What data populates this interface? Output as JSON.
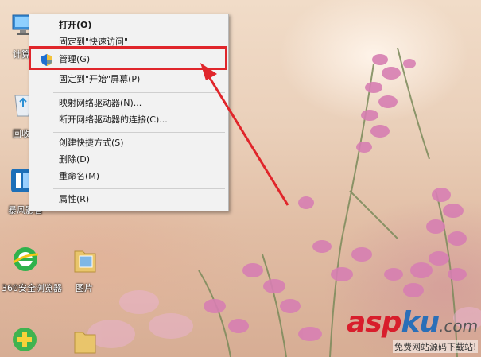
{
  "desktop_icons": [
    {
      "id": "computer",
      "label": "计算",
      "icon": "computer-icon"
    },
    {
      "id": "recycle",
      "label": "回收",
      "icon": "recycle-bin-icon"
    },
    {
      "id": "storm",
      "label": "暴风影音",
      "icon": "video-player-icon"
    },
    {
      "id": "browser",
      "label": "360安全浏览器",
      "icon": "browser-icon"
    },
    {
      "id": "pictures",
      "label": "图片",
      "icon": "folder-icon"
    },
    {
      "id": "guard",
      "label": "",
      "icon": "security-guard-icon"
    },
    {
      "id": "folder2",
      "label": "",
      "icon": "folder-icon"
    }
  ],
  "context_menu": {
    "items": [
      {
        "label": "打开(O)",
        "bold": true
      },
      {
        "label": "固定到\"快速访问\""
      },
      {
        "label": "管理(G)",
        "icon": "admin-shield-icon",
        "highlighted": true
      },
      {
        "label": "固定到\"开始\"屏幕(P)"
      },
      {
        "label": "映射网络驱动器(N)..."
      },
      {
        "label": "断开网络驱动器的连接(C)..."
      },
      {
        "label": "创建快捷方式(S)"
      },
      {
        "label": "删除(D)"
      },
      {
        "label": "重命名(M)"
      },
      {
        "label": "属性(R)"
      }
    ]
  },
  "annotation": {
    "color": "#e0262b",
    "shape": "red-box-and-arrow"
  },
  "watermark": {
    "part1": "asp",
    "part2": "ku",
    "suffix": ".com",
    "sub": "免费网站源码下载站!"
  }
}
